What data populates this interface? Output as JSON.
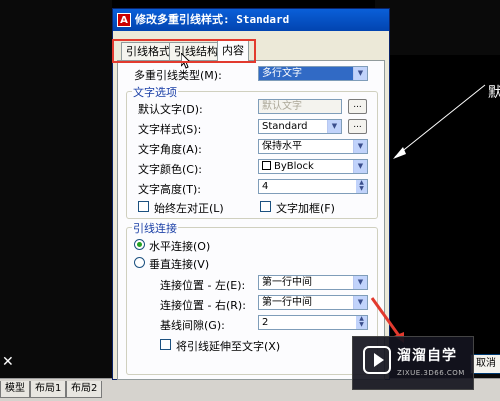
{
  "dialog": {
    "title": "修改多重引线样式: Standard",
    "tabs": [
      "引线格式",
      "引线结构",
      "内容"
    ],
    "content": {
      "mleader_type_label": "多重引线类型(M):",
      "mleader_type_value": "多行文字",
      "text_options": {
        "group_title": "文字选项",
        "default_text_label": "默认文字(D):",
        "default_text_value": "默认文字",
        "default_text_button": "...",
        "text_style_label": "文字样式(S):",
        "text_style_value": "Standard",
        "text_style_button": "...",
        "text_angle_label": "文字角度(A):",
        "text_angle_value": "保持水平",
        "text_color_label": "文字颜色(C):",
        "text_color_value": "ByBlock",
        "text_height_label": "文字高度(T):",
        "text_height_value": "4",
        "always_left_justify_label": "始终左对正(L)",
        "text_frame_label": "文字加框(F)"
      },
      "leader_connection": {
        "group_title": "引线连接",
        "horizontal_label": "水平连接(O)",
        "vertical_label": "垂直连接(V)",
        "left_attachment_label": "连接位置 - 左(E):",
        "left_attachment_value": "第一行中间",
        "right_attachment_label": "连接位置 - 右(R):",
        "right_attachment_value": "第一行中间",
        "landing_gap_label": "基线间隙(G):",
        "landing_gap_value": "2",
        "extend_leader_label": "将引线延伸至文字(X)"
      }
    },
    "cancel_partial": "取消"
  },
  "preview": {
    "text": "默"
  },
  "layout_tabs": [
    "模型",
    "布局1",
    "布局2"
  ],
  "watermark": {
    "name": "溜溜自学",
    "url": "ZIXUE.3D66.COM"
  },
  "colors": {
    "highlight": "#e23a2e",
    "titlebar": "#0a5fd8",
    "group_title": "#1a3fa6"
  },
  "icons": [
    "autocad-icon",
    "dropdown-arrow-icon",
    "spinner-icon",
    "crosshair-icon",
    "play-logo-icon",
    "arrow-annotation-icon"
  ]
}
